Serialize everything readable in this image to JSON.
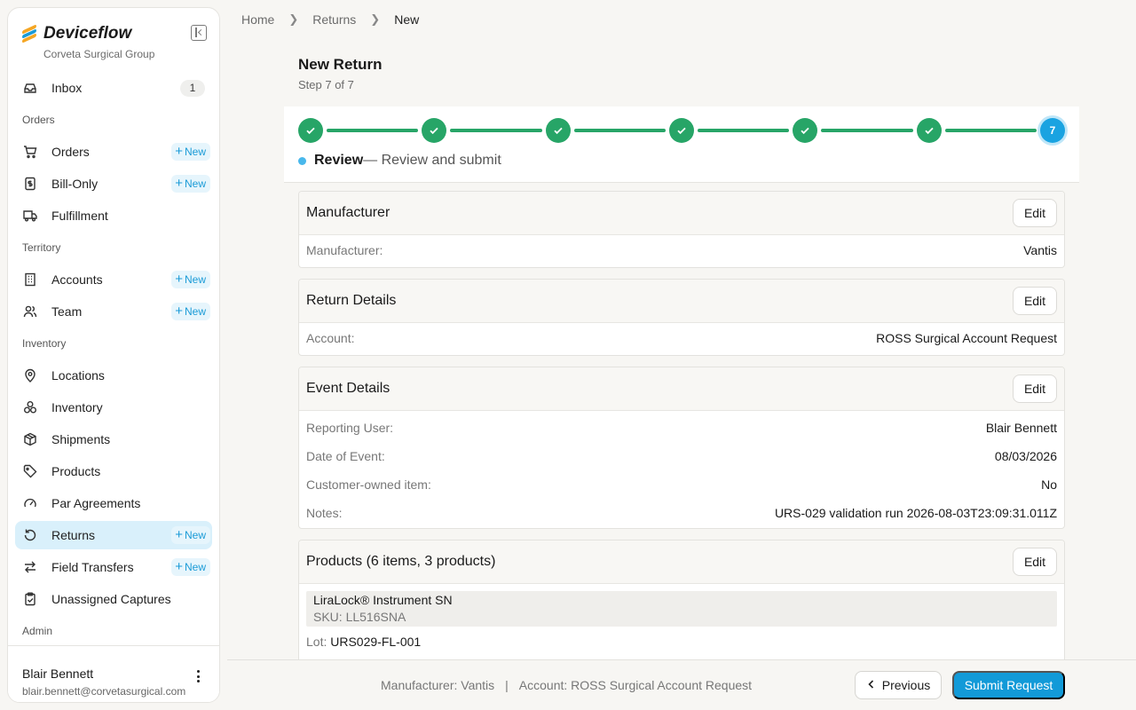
{
  "brand": {
    "name": "Deviceflow",
    "org": "Corveta Surgical Group"
  },
  "sidebar": {
    "new_label": "New",
    "inbox": {
      "label": "Inbox",
      "count": "1"
    },
    "sections": {
      "orders": "Orders",
      "territory": "Territory",
      "inventory": "Inventory",
      "admin": "Admin"
    },
    "items": {
      "orders": "Orders",
      "bill_only": "Bill-Only",
      "fulfillment": "Fulfillment",
      "accounts": "Accounts",
      "team": "Team",
      "locations": "Locations",
      "inventory": "Inventory",
      "shipments": "Shipments",
      "products": "Products",
      "par_agreements": "Par Agreements",
      "returns": "Returns",
      "field_transfers": "Field Transfers",
      "unassigned_captures": "Unassigned Captures"
    },
    "user": {
      "name": "Blair Bennett",
      "email": "blair.bennett@corvetasurgical.com"
    }
  },
  "breadcrumb": {
    "home": "Home",
    "returns": "Returns",
    "current": "New"
  },
  "page": {
    "title": "New Return",
    "step": "Step 7 of 7"
  },
  "stepper": {
    "total": 7,
    "current": 7,
    "current_label": "7",
    "current_name": "Review",
    "current_desc": "— Review and submit",
    "complete_color": "#27a567",
    "current_color": "#1aa3e1"
  },
  "review": {
    "edit_label": "Edit",
    "manufacturer": {
      "title": "Manufacturer",
      "k": "Manufacturer:",
      "v": "Vantis"
    },
    "return_details": {
      "title": "Return Details",
      "k": "Account:",
      "v": "ROSS Surgical Account Request"
    },
    "event_details": {
      "title": "Event Details",
      "rows": [
        {
          "k": "Reporting User:",
          "v": "Blair Bennett"
        },
        {
          "k": "Date of Event:",
          "v": "08/03/2026"
        },
        {
          "k": "Customer-owned item:",
          "v": "No"
        },
        {
          "k": "Notes:",
          "v": "URS-029 validation run 2026-08-03T23:09:31.011Z"
        }
      ]
    },
    "products": {
      "title": "Products (6 items, 3 products)",
      "item": {
        "name": "LiraLock® Instrument SN",
        "sku": "SKU: LL516SNA",
        "lot_label": "Lot:",
        "lot_value": "URS029-FL-001"
      }
    }
  },
  "footer": {
    "manufacturer_label": "Manufacturer:",
    "manufacturer_value": "Vantis",
    "divider": "|",
    "account_label": "Account:",
    "account_value": "ROSS Surgical Account Request",
    "previous": "Previous",
    "submit": "Submit Request"
  },
  "colors": {
    "accent": "#129ad8",
    "success": "#27a567",
    "active_nav": "#d9f0fb"
  }
}
